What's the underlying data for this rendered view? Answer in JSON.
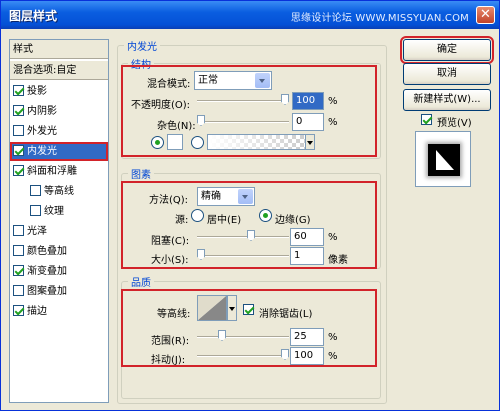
{
  "window": {
    "title": "图层样式",
    "watermark": "思缘设计论坛 WWW.MISSYUAN.COM",
    "close_glyph": "✕"
  },
  "style_list": {
    "header": "样式",
    "blend_options": "混合选项:自定",
    "items": [
      {
        "label": "投影",
        "checked": true
      },
      {
        "label": "内阴影",
        "checked": true
      },
      {
        "label": "外发光",
        "checked": false
      },
      {
        "label": "内发光",
        "checked": true,
        "selected": true
      },
      {
        "label": "斜面和浮雕",
        "checked": true
      },
      {
        "label": "等高线",
        "checked": false,
        "sub": true
      },
      {
        "label": "纹理",
        "checked": false,
        "sub": true
      },
      {
        "label": "光泽",
        "checked": false
      },
      {
        "label": "颜色叠加",
        "checked": false
      },
      {
        "label": "渐变叠加",
        "checked": true
      },
      {
        "label": "图案叠加",
        "checked": false
      },
      {
        "label": "描边",
        "checked": true
      }
    ]
  },
  "panel": {
    "title": "内发光",
    "structure": {
      "title": "结构",
      "blend_mode_label": "混合模式:",
      "blend_mode_value": "正常",
      "opacity_label": "不透明度(O):",
      "opacity_value": "100",
      "opacity_unit": "%",
      "opacity_level": 1.0,
      "noise_label": "杂色(N):",
      "noise_value": "0",
      "noise_unit": "%",
      "noise_level": 0.0
    },
    "elements": {
      "title": "图素",
      "method_label": "方法(Q):",
      "method_value": "精确",
      "source_label": "源:",
      "source_center": "居中(E)",
      "source_edge": "边缘(G)",
      "choke_label": "阻塞(C):",
      "choke_value": "60",
      "choke_unit": "%",
      "choke_level": 0.6,
      "size_label": "大小(S):",
      "size_value": "1",
      "size_unit": "像素",
      "size_level": 0.0
    },
    "quality": {
      "title": "品质",
      "contour_label": "等高线:",
      "antialias_label": "消除锯齿(L)",
      "range_label": "范围(R):",
      "range_value": "25",
      "range_unit": "%",
      "range_level": 0.25,
      "jitter_label": "抖动(J):",
      "jitter_value": "100",
      "jitter_unit": "%",
      "jitter_level": 1.0
    }
  },
  "buttons": {
    "ok": "确定",
    "cancel": "取消",
    "new_style": "新建样式(W)...",
    "preview_label": "预览(V)"
  },
  "colors": {
    "accent": "#316ac5",
    "highlight": "#d2232a",
    "group_title": "#0046d5"
  }
}
